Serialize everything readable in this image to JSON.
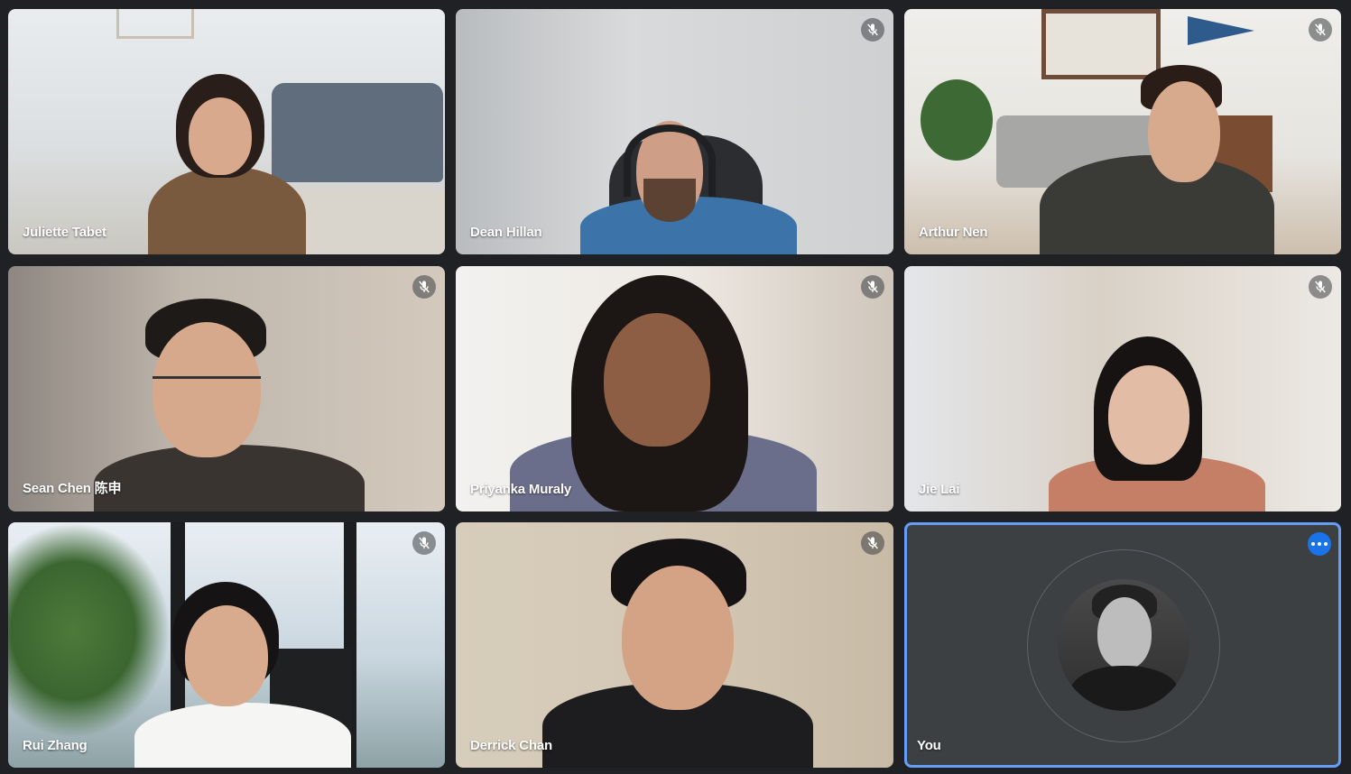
{
  "app": {
    "background": "#202124",
    "accent": "#1a73e8"
  },
  "participants": [
    {
      "name": "Juliette Tabet",
      "muted": false
    },
    {
      "name": "Dean Hillan",
      "muted": true
    },
    {
      "name": "Arthur Nen",
      "muted": true
    },
    {
      "name": "Sean Chen 陈申",
      "muted": true
    },
    {
      "name": "Priyanka Muraly",
      "muted": true
    },
    {
      "name": "Jie Lai",
      "muted": true
    },
    {
      "name": "Rui Zhang",
      "muted": true
    },
    {
      "name": "Derrick Chan",
      "muted": true
    },
    {
      "name": "You",
      "muted": false,
      "self": true
    }
  ],
  "icons": {
    "muted": "mic-off-icon",
    "more": "more-options-icon"
  }
}
